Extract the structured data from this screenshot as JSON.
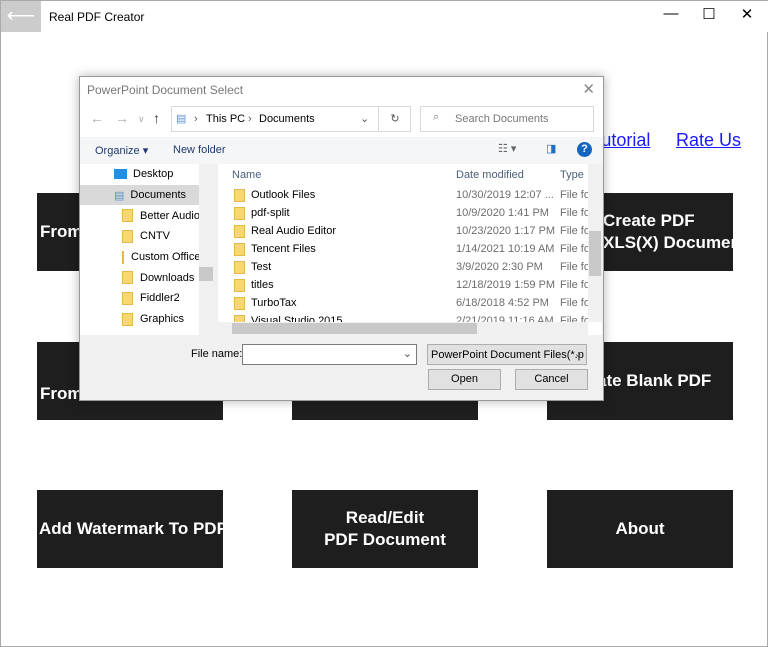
{
  "app": {
    "title": "Real PDF Creator",
    "links": [
      "Tutorial",
      "Rate Us"
    ],
    "tiles": [
      {
        "label": "From"
      },
      {
        "label": "Create PDF",
        "label2": "XLS(X) Document"
      },
      {
        "label": "From"
      },
      {
        "label": ""
      },
      {
        "label": "Create Blank PDF"
      },
      {
        "label": "Add Watermark To PDF"
      },
      {
        "label": "Read/Edit",
        "label2": "PDF Document"
      },
      {
        "label": "About"
      }
    ]
  },
  "dialog": {
    "title": "PowerPoint Document Select",
    "breadcrumb": [
      "This PC",
      "Documents"
    ],
    "search_placeholder": "Search Documents",
    "organize": "Organize ▾",
    "new_folder": "New folder",
    "tree": [
      {
        "label": "Desktop"
      },
      {
        "label": "Documents"
      },
      {
        "label": "Better Audio"
      },
      {
        "label": "CNTV"
      },
      {
        "label": "Custom Office"
      },
      {
        "label": "Downloads"
      },
      {
        "label": "Fiddler2"
      },
      {
        "label": "Graphics"
      }
    ],
    "columns": {
      "name": "Name",
      "date": "Date modified",
      "type": "Type"
    },
    "files": [
      {
        "name": "Outlook Files",
        "date": "10/30/2019 12:07 ...",
        "type": "File folder"
      },
      {
        "name": "pdf-split",
        "date": "10/9/2020 1:41 PM",
        "type": "File folder"
      },
      {
        "name": "Real Audio Editor",
        "date": "10/23/2020 1:17 PM",
        "type": "File folder"
      },
      {
        "name": "Tencent Files",
        "date": "1/14/2021 10:19 AM",
        "type": "File folder"
      },
      {
        "name": "Test",
        "date": "3/9/2020 2:30 PM",
        "type": "File folder"
      },
      {
        "name": "titles",
        "date": "12/18/2019 1:59 PM",
        "type": "File folder"
      },
      {
        "name": "TurboTax",
        "date": "6/18/2018 4:52 PM",
        "type": "File folder"
      },
      {
        "name": "Visual Studio 2015",
        "date": "2/21/2019 11:16 AM",
        "type": "File folder"
      }
    ],
    "file_name_label": "File name:",
    "file_name_value": "",
    "filter": "PowerPoint Document Files(*.p",
    "open": "Open",
    "cancel": "Cancel"
  }
}
